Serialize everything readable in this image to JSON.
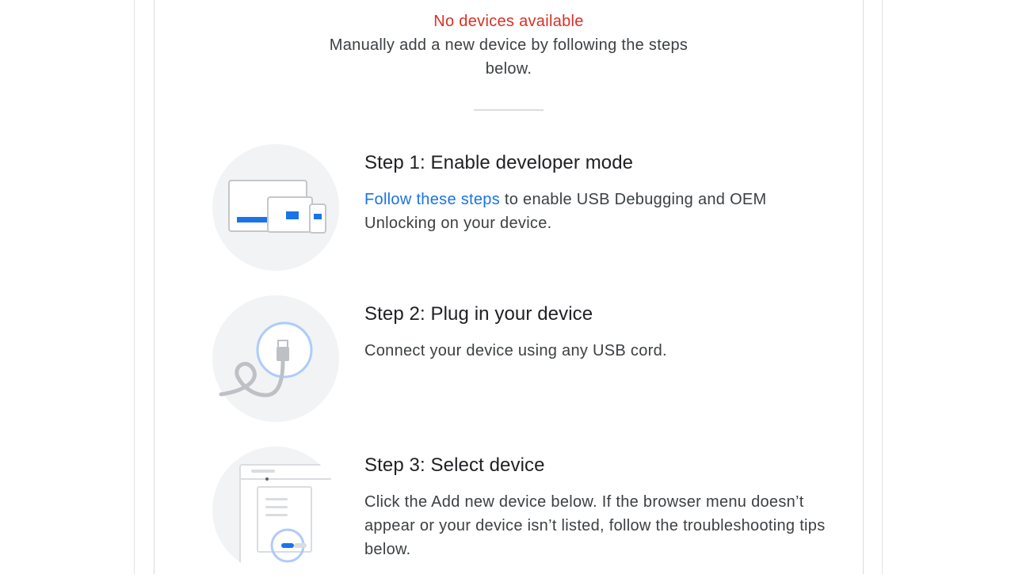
{
  "status": {
    "title": "No devices available",
    "hint": "Manually add a new device by following the steps below."
  },
  "steps": [
    {
      "title": "Step 1: Enable developer mode",
      "link_text": "Follow these steps",
      "body_after_link": " to enable USB Debugging and OEM Unlocking on your device."
    },
    {
      "title": "Step 2: Plug in your device",
      "body": "Connect your device using any USB cord."
    },
    {
      "title": "Step 3: Select device",
      "body": "Click the Add new device below. If the browser menu doesn’t appear or your device isn’t listed, follow the troubleshooting tips below."
    }
  ],
  "colors": {
    "error_red": "#d93025",
    "link_blue": "#1a73e8",
    "accent_blue": "#1a73e8",
    "illustration_bg": "#f1f3f4"
  },
  "icons": {
    "step1": "devices-illustration-icon",
    "step2": "usb-cable-illustration-icon",
    "step3": "browser-select-illustration-icon"
  }
}
